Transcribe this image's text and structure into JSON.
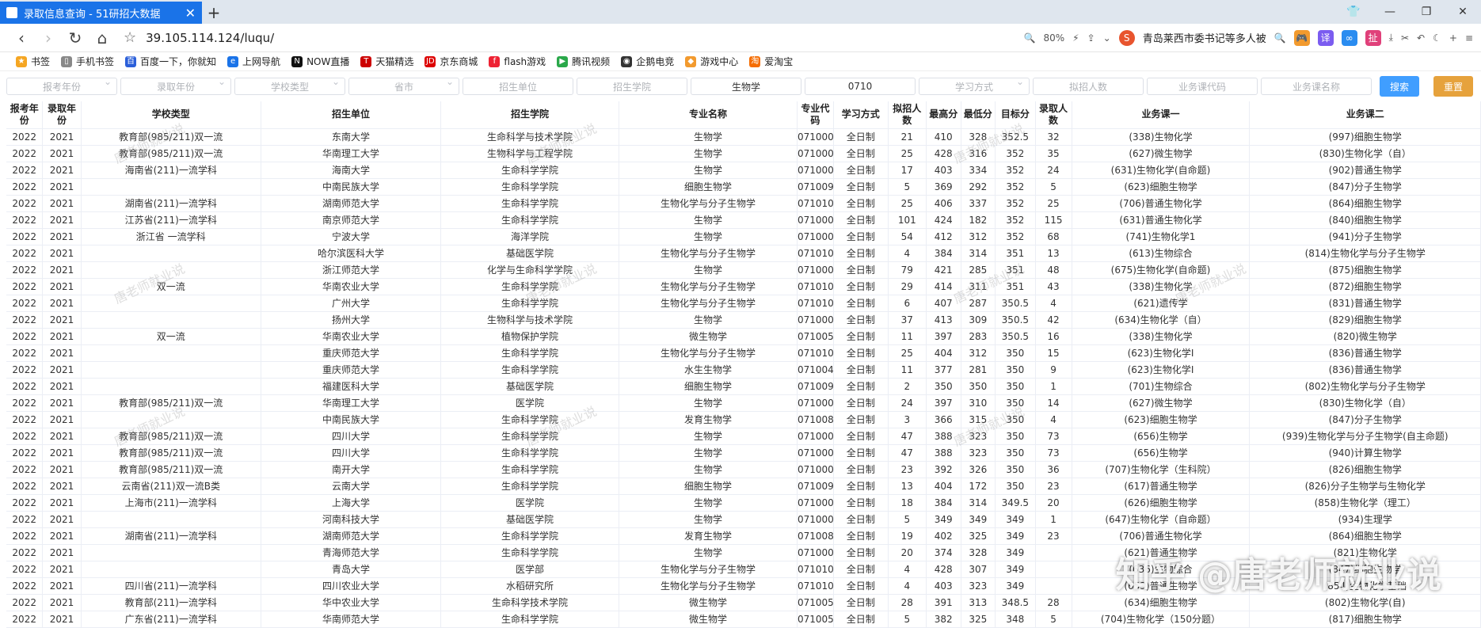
{
  "browser": {
    "tab_title": "录取信息查询 - 51研招大数据",
    "url": "39.105.114.124/luqu/",
    "zoom": "80%",
    "hot_search": "青岛莱西市委书记等多人被"
  },
  "bookmarks": [
    "书签",
    "手机书签",
    "百度一下，你就知",
    "上网导航",
    "NOW直播",
    "天猫精选",
    "京东商城",
    "flash游戏",
    "腾讯视频",
    "企鹅电竞",
    "游戏中心",
    "爱淘宝"
  ],
  "filters": {
    "exam_year": "报考年份",
    "admit_year": "录取年份",
    "school_type": "学校类型",
    "province": "省市",
    "unit": "招生单位",
    "college": "招生学院",
    "major": "生物学",
    "code": "0710",
    "study_mode": "学习方式",
    "plan": "拟招人数",
    "course_code": "业务课代码",
    "course_name": "业务课名称",
    "search": "搜索",
    "reset": "重置"
  },
  "table": {
    "headers": [
      "报考年份",
      "录取年份",
      "学校类型",
      "招生单位",
      "招生学院",
      "专业名称",
      "专业代码",
      "学习方式",
      "拟招人数",
      "最高分",
      "最低分",
      "目标分",
      "录取人数",
      "业务课一",
      "业务课二"
    ],
    "rows": [
      [
        "2022",
        "2021",
        "教育部(985/211)双一流",
        "东南大学",
        "生命科学与技术学院",
        "生物学",
        "071000",
        "全日制",
        "21",
        "410",
        "328",
        "352.5",
        "32",
        "(338)生物化学",
        "(997)细胞生物学"
      ],
      [
        "2022",
        "2021",
        "教育部(985/211)双一流",
        "华南理工大学",
        "生物科学与工程学院",
        "生物学",
        "071000",
        "全日制",
        "25",
        "428",
        "316",
        "352",
        "35",
        "(627)微生物学",
        "(830)生物化学（自）"
      ],
      [
        "2022",
        "2021",
        "海南省(211)一流学科",
        "海南大学",
        "生命科学学院",
        "生物学",
        "071000",
        "全日制",
        "17",
        "403",
        "334",
        "352",
        "24",
        "(631)生物化学(自命题)",
        "(902)普通生物学"
      ],
      [
        "2022",
        "2021",
        "",
        "中南民族大学",
        "生命科学学院",
        "细胞生物学",
        "071009",
        "全日制",
        "5",
        "369",
        "292",
        "352",
        "5",
        "(623)细胞生物学",
        "(847)分子生物学"
      ],
      [
        "2022",
        "2021",
        "湖南省(211)一流学科",
        "湖南师范大学",
        "生命科学学院",
        "生物化学与分子生物学",
        "071010",
        "全日制",
        "25",
        "406",
        "337",
        "352",
        "25",
        "(706)普通生物化学",
        "(864)细胞生物学"
      ],
      [
        "2022",
        "2021",
        "江苏省(211)一流学科",
        "南京师范大学",
        "生命科学学院",
        "生物学",
        "071000",
        "全日制",
        "101",
        "424",
        "182",
        "352",
        "115",
        "(631)普通生物化学",
        "(840)细胞生物学"
      ],
      [
        "2022",
        "2021",
        "浙江省 一流学科",
        "宁波大学",
        "海洋学院",
        "生物学",
        "071000",
        "全日制",
        "54",
        "412",
        "312",
        "352",
        "68",
        "(741)生物化学1",
        "(941)分子生物学"
      ],
      [
        "2022",
        "2021",
        "",
        "哈尔滨医科大学",
        "基础医学院",
        "生物化学与分子生物学",
        "071010",
        "全日制",
        "4",
        "384",
        "314",
        "351",
        "13",
        "(613)生物综合",
        "(814)生物化学与分子生物学"
      ],
      [
        "2022",
        "2021",
        "",
        "浙江师范大学",
        "化学与生命科学学院",
        "生物学",
        "071000",
        "全日制",
        "79",
        "421",
        "285",
        "351",
        "48",
        "(675)生物化学(自命题)",
        "(875)细胞生物学"
      ],
      [
        "2022",
        "2021",
        "双一流",
        "华南农业大学",
        "生命科学学院",
        "生物化学与分子生物学",
        "071010",
        "全日制",
        "29",
        "414",
        "311",
        "351",
        "43",
        "(338)生物化学",
        "(872)细胞生物学"
      ],
      [
        "2022",
        "2021",
        "",
        "广州大学",
        "生命科学学院",
        "生物化学与分子生物学",
        "071010",
        "全日制",
        "6",
        "407",
        "287",
        "350.5",
        "4",
        "(621)遗传学",
        "(831)普通生物学"
      ],
      [
        "2022",
        "2021",
        "",
        "扬州大学",
        "生物科学与技术学院",
        "生物学",
        "071000",
        "全日制",
        "37",
        "413",
        "309",
        "350.5",
        "42",
        "(634)生物化学（自）",
        "(829)细胞生物学"
      ],
      [
        "2022",
        "2021",
        "双一流",
        "华南农业大学",
        "植物保护学院",
        "微生物学",
        "071005",
        "全日制",
        "11",
        "397",
        "283",
        "350.5",
        "16",
        "(338)生物化学",
        "(820)微生物学"
      ],
      [
        "2022",
        "2021",
        "",
        "重庆师范大学",
        "生命科学学院",
        "生物化学与分子生物学",
        "071010",
        "全日制",
        "25",
        "404",
        "312",
        "350",
        "15",
        "(623)生物化学I",
        "(836)普通生物学"
      ],
      [
        "2022",
        "2021",
        "",
        "重庆师范大学",
        "生命科学学院",
        "水生生物学",
        "071004",
        "全日制",
        "11",
        "377",
        "281",
        "350",
        "9",
        "(623)生物化学I",
        "(836)普通生物学"
      ],
      [
        "2022",
        "2021",
        "",
        "福建医科大学",
        "基础医学院",
        "细胞生物学",
        "071009",
        "全日制",
        "2",
        "350",
        "350",
        "350",
        "1",
        "(701)生物综合",
        "(802)生物化学与分子生物学"
      ],
      [
        "2022",
        "2021",
        "教育部(985/211)双一流",
        "华南理工大学",
        "医学院",
        "生物学",
        "071000",
        "全日制",
        "24",
        "397",
        "310",
        "350",
        "14",
        "(627)微生物学",
        "(830)生物化学（自）"
      ],
      [
        "2022",
        "2021",
        "",
        "中南民族大学",
        "生命科学学院",
        "发育生物学",
        "071008",
        "全日制",
        "3",
        "366",
        "315",
        "350",
        "4",
        "(623)细胞生物学",
        "(847)分子生物学"
      ],
      [
        "2022",
        "2021",
        "教育部(985/211)双一流",
        "四川大学",
        "生命科学学院",
        "生物学",
        "071000",
        "全日制",
        "47",
        "388",
        "323",
        "350",
        "73",
        "(656)生物学",
        "(939)生物化学与分子生物学(自主命题)"
      ],
      [
        "2022",
        "2021",
        "教育部(985/211)双一流",
        "四川大学",
        "生命科学学院",
        "生物学",
        "071000",
        "全日制",
        "47",
        "388",
        "323",
        "350",
        "73",
        "(656)生物学",
        "(940)计算生物学"
      ],
      [
        "2022",
        "2021",
        "教育部(985/211)双一流",
        "南开大学",
        "生命科学学院",
        "生物学",
        "071000",
        "全日制",
        "23",
        "392",
        "326",
        "350",
        "36",
        "(707)生物化学（生科院）",
        "(826)细胞生物学"
      ],
      [
        "2022",
        "2021",
        "云南省(211)双一流B类",
        "云南大学",
        "生命科学学院",
        "细胞生物学",
        "071009",
        "全日制",
        "13",
        "404",
        "172",
        "350",
        "23",
        "(617)普通生物学",
        "(826)分子生物学与生物化学"
      ],
      [
        "2022",
        "2021",
        "上海市(211)一流学科",
        "上海大学",
        "医学院",
        "生物学",
        "071000",
        "全日制",
        "18",
        "384",
        "314",
        "349.5",
        "20",
        "(626)细胞生物学",
        "(858)生物化学（理工）"
      ],
      [
        "2022",
        "2021",
        "",
        "河南科技大学",
        "基础医学院",
        "生物学",
        "071000",
        "全日制",
        "5",
        "349",
        "349",
        "349",
        "1",
        "(647)生物化学（自命题）",
        "(934)生理学"
      ],
      [
        "2022",
        "2021",
        "湖南省(211)一流学科",
        "湖南师范大学",
        "生命科学学院",
        "发育生物学",
        "071008",
        "全日制",
        "19",
        "402",
        "325",
        "349",
        "23",
        "(706)普通生物化学",
        "(864)细胞生物学"
      ],
      [
        "2022",
        "2021",
        "",
        "青海师范大学",
        "生命科学学院",
        "生物学",
        "071000",
        "全日制",
        "20",
        "374",
        "328",
        "349",
        "",
        "(621)普通生物学",
        "(821)生物化学"
      ],
      [
        "2022",
        "2021",
        "",
        "青岛大学",
        "医学部",
        "生物化学与分子生物学",
        "071010",
        "全日制",
        "4",
        "428",
        "307",
        "349",
        "",
        "(636)生物综合",
        "(847)细胞生物学"
      ],
      [
        "2022",
        "2021",
        "四川省(211)一流学科",
        "四川农业大学",
        "水稻研究所",
        "生物化学与分子生物学",
        "071010",
        "全日制",
        "4",
        "403",
        "323",
        "349",
        "",
        "(653)普通生物学",
        "(854)生物化学基础"
      ],
      [
        "2022",
        "2021",
        "教育部(211)一流学科",
        "华中农业大学",
        "生命科学技术学院",
        "微生物学",
        "071005",
        "全日制",
        "28",
        "391",
        "313",
        "348.5",
        "28",
        "(634)细胞生物学",
        "(802)生物化学(自)"
      ],
      [
        "2022",
        "2021",
        "广东省(211)一流学科",
        "华南师范大学",
        "生命科学学院",
        "微生物学",
        "071005",
        "全日制",
        "5",
        "382",
        "325",
        "348",
        "5",
        "(704)生物化学（150分题）",
        "(817)细胞生物学"
      ]
    ]
  },
  "watermark": "唐老师就业说",
  "big_watermark": "知乎 @唐老师就业说"
}
